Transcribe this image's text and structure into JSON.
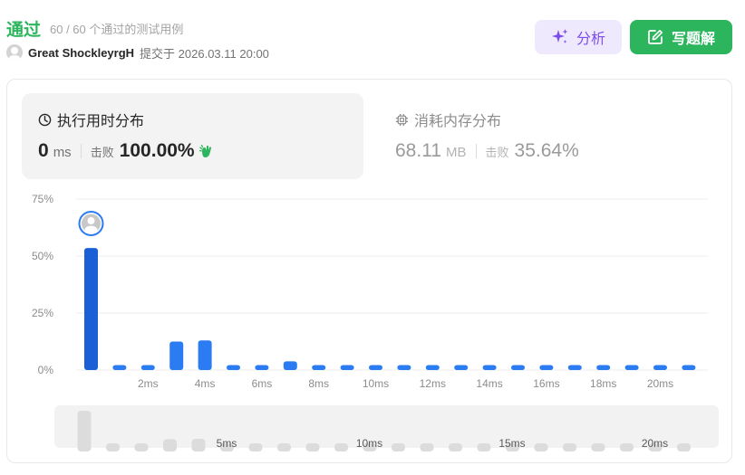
{
  "status": {
    "title": "通过",
    "testcases": "60 / 60 个通过的测试用例",
    "username": "Great ShockleyrgH",
    "submitted_at": "提交于 2026.03.11 20:00"
  },
  "actions": {
    "analyze_label": "分析",
    "solution_label": "写题解"
  },
  "runtime": {
    "title": "执行用时分布",
    "value": "0",
    "unit": "ms",
    "beat_label": "击败",
    "beat_value": "100.00%"
  },
  "memory": {
    "title": "消耗内存分布",
    "value": "68.11",
    "unit": "MB",
    "beat_label": "击败",
    "beat_value": "35.64%"
  },
  "colors": {
    "accent_green": "#2db55d",
    "bar_blue": "#2b7bf3",
    "bar_selected": "#1a5fd6",
    "analyze_purple": "#7c4ded"
  },
  "chart_data": [
    {
      "type": "bar",
      "title": "",
      "ylabel": "",
      "xlabel": "",
      "y_ticks": [
        "75%",
        "50%",
        "25%",
        "0%"
      ],
      "ylim": [
        0,
        75
      ],
      "x_tick_labels": [
        "2ms",
        "4ms",
        "6ms",
        "8ms",
        "10ms",
        "12ms",
        "14ms",
        "16ms",
        "18ms",
        "20ms"
      ],
      "categories_ms": [
        0,
        1,
        2,
        3,
        4,
        5,
        6,
        7,
        8,
        9,
        10,
        11,
        12,
        13,
        14,
        15,
        16,
        17,
        18,
        19,
        20,
        21
      ],
      "values": [
        53.5,
        2.2,
        2.2,
        12.5,
        13.0,
        2.2,
        2.2,
        3.8,
        2.2,
        2.2,
        2.2,
        2.2,
        2.2,
        2.2,
        2.2,
        2.2,
        2.2,
        2.2,
        2.2,
        2.2,
        2.2,
        2.2
      ],
      "highlighted_index": 0,
      "grid": true
    },
    {
      "type": "bar",
      "title": "",
      "x_tick_labels": [
        "5ms",
        "10ms",
        "15ms",
        "20ms"
      ],
      "values": [
        53.5,
        2.2,
        2.2,
        12.5,
        13.0,
        2.2,
        2.2,
        3.8,
        2.2,
        2.2,
        2.2,
        2.2,
        2.2,
        2.2,
        2.2,
        2.2,
        2.2,
        2.2,
        2.2,
        2.2,
        2.2,
        2.2
      ]
    }
  ]
}
